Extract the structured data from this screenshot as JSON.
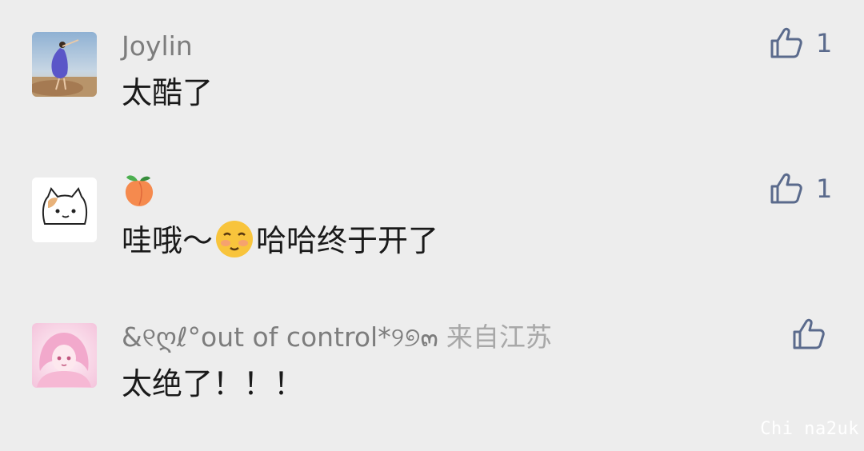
{
  "comments": [
    {
      "name": "Joylin",
      "text": "太酷了",
      "like_count": "1",
      "avatar": "dancer-photo"
    },
    {
      "name_icon": "peach-emoji",
      "text_before": "哇哦～",
      "text_emoji": "flushed-smile-emoji",
      "text_after": "哈哈终于开了",
      "like_count": "1",
      "avatar": "cat-drawing"
    },
    {
      "name": "&୧ღℓ°out of control*୨୭๓",
      "location": "来自江苏",
      "text": "太绝了！！！",
      "avatar": "anime-girl"
    }
  ],
  "watermark": "Chi na2uk",
  "colors": {
    "background": "#ededed",
    "name": "#7d7d7d",
    "text": "#1a1a1a",
    "like": "#5a6a8c"
  }
}
